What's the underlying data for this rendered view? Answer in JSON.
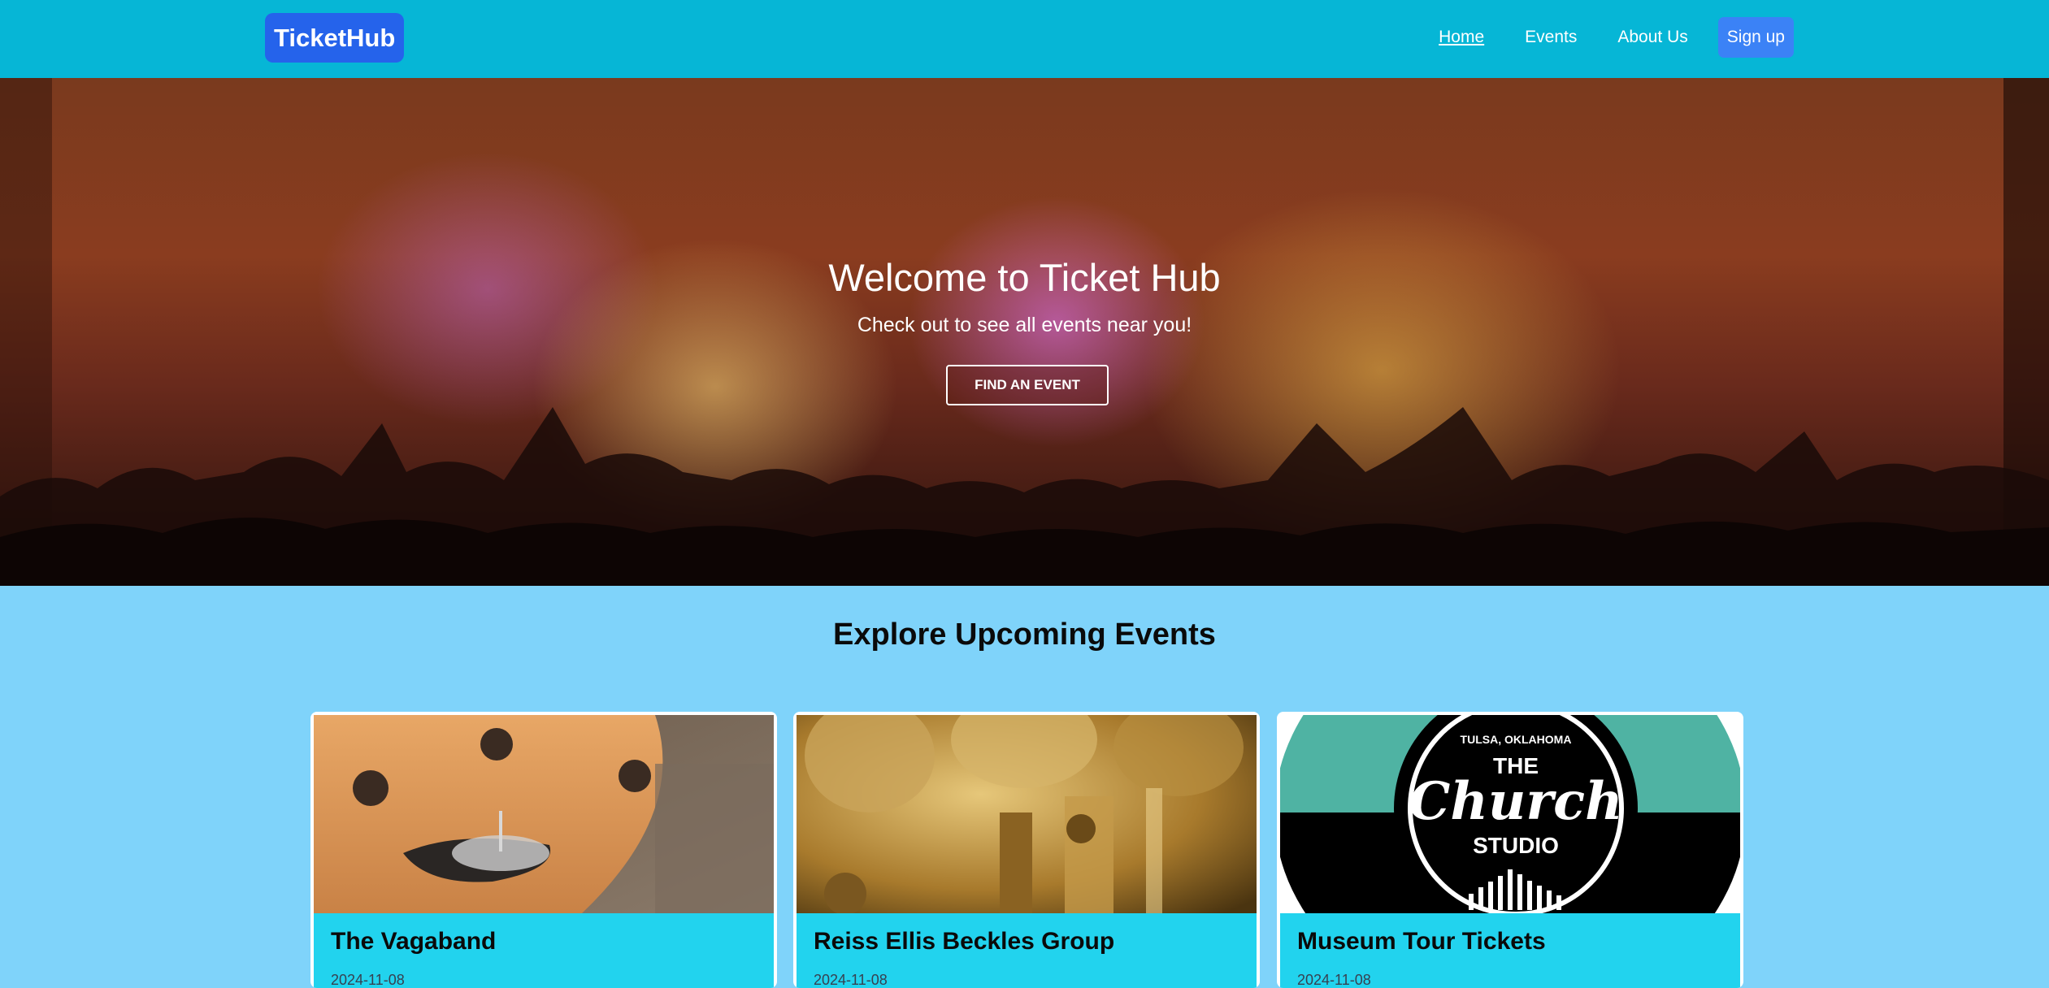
{
  "brand": "TicketHub",
  "nav": {
    "links": [
      "Home",
      "Events",
      "About Us"
    ],
    "signup": "Sign up"
  },
  "hero": {
    "title": "Welcome to Ticket Hub",
    "subtitle": "Check out to see all events near you!",
    "button": "FIND AN EVENT"
  },
  "section": {
    "title": "Explore Upcoming Events"
  },
  "events": [
    {
      "title": "The Vagaband",
      "date": "2024-11-08"
    },
    {
      "title": "Reiss Ellis Beckles Group",
      "date": "2024-11-08"
    },
    {
      "title": "Museum Tour Tickets",
      "date": "2024-11-08"
    }
  ],
  "logo_text": {
    "arc": "TULSA, OKLAHOMA",
    "line1": "THE",
    "line2": "Church",
    "line3": "STUDIO"
  }
}
